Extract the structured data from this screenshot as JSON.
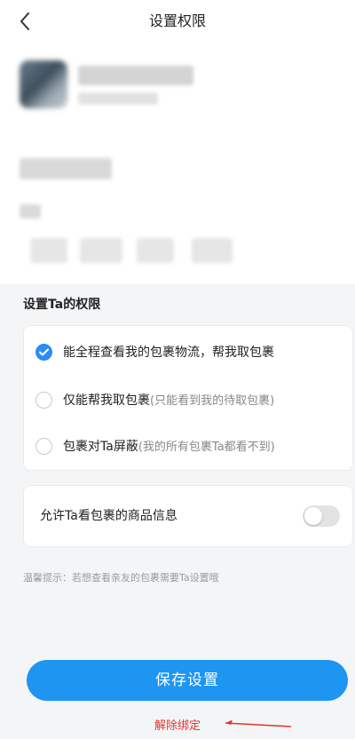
{
  "header": {
    "title": "设置权限",
    "back_icon": "chevron-left-icon"
  },
  "permissions": {
    "section_title": "设置Ta的权限",
    "options": [
      {
        "label": "能全程查看我的包裹物流，帮我取包裹",
        "note": "",
        "selected": true
      },
      {
        "label": "仅能帮我取包裹",
        "note": "(只能看到我的待取包裹)",
        "selected": false
      },
      {
        "label": "包裹对Ta屏蔽",
        "note": "(我的所有包裹Ta都看不到)",
        "selected": false
      }
    ]
  },
  "product_info": {
    "label": "允许Ta看包裹的商品信息",
    "enabled": false
  },
  "hint": "温馨提示：若想查看亲友的包裹需要Ta设置哦",
  "actions": {
    "save_label": "保存设置",
    "unbind_label": "解除绑定"
  },
  "colors": {
    "accent": "#1f95f2",
    "danger": "#e0352b"
  }
}
